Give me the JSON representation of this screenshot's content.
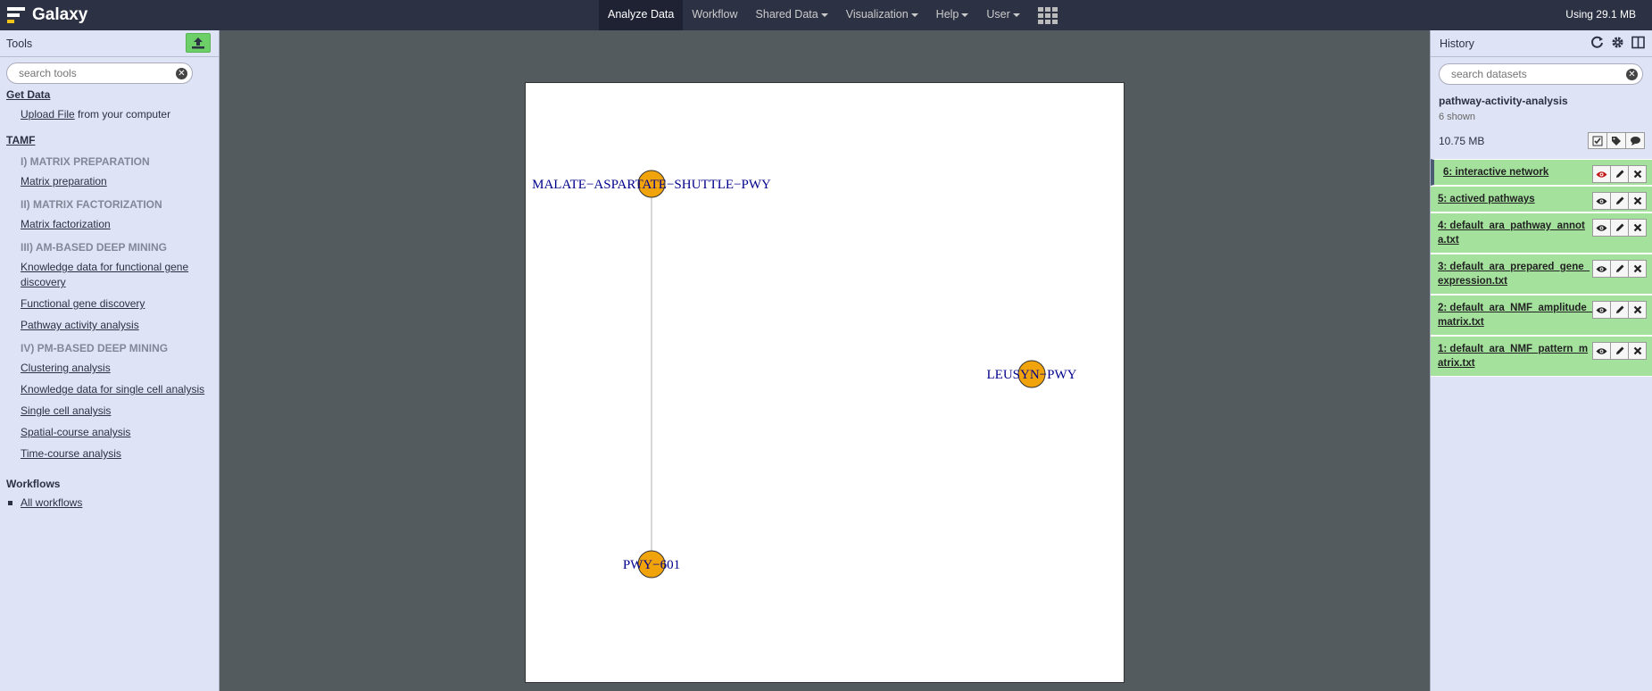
{
  "masthead": {
    "brand": "Galaxy",
    "nav": [
      {
        "label": "Analyze Data",
        "active": true,
        "dropdown": false
      },
      {
        "label": "Workflow",
        "active": false,
        "dropdown": false
      },
      {
        "label": "Shared Data",
        "active": false,
        "dropdown": true
      },
      {
        "label": "Visualization",
        "active": false,
        "dropdown": true
      },
      {
        "label": "Help",
        "active": false,
        "dropdown": true
      },
      {
        "label": "User",
        "active": false,
        "dropdown": true
      }
    ],
    "quota": "Using 29.1 MB"
  },
  "tools": {
    "title": "Tools",
    "search_placeholder": "search tools",
    "get_data": {
      "title": "Get Data",
      "upload_link": "Upload File",
      "upload_suffix": " from your computer"
    },
    "section_title": "TAMF",
    "items": [
      {
        "type": "label",
        "text": "I) MATRIX PREPARATION"
      },
      {
        "type": "link",
        "text": "Matrix preparation"
      },
      {
        "type": "label",
        "text": "II) MATRIX FACTORIZATION"
      },
      {
        "type": "link",
        "text": "Matrix factorization"
      },
      {
        "type": "label",
        "text": "III) AM-BASED DEEP MINING"
      },
      {
        "type": "link",
        "text": "Knowledge data for functional gene discovery"
      },
      {
        "type": "link",
        "text": "Functional gene discovery"
      },
      {
        "type": "link",
        "text": "Pathway activity analysis"
      },
      {
        "type": "label",
        "text": "IV) PM-BASED DEEP MINING"
      },
      {
        "type": "link",
        "text": "Clustering analysis"
      },
      {
        "type": "link",
        "text": "Knowledge data for single cell analysis"
      },
      {
        "type": "link",
        "text": "Single cell analysis"
      },
      {
        "type": "link",
        "text": "Spatial-course analysis"
      },
      {
        "type": "link",
        "text": "Time-course analysis"
      }
    ],
    "workflows_title": "Workflows",
    "workflows_link": "All workflows"
  },
  "network": {
    "nodes": [
      {
        "id": "malate",
        "label": "MALATE−ASPARTATE−SHUTTLE−PWY"
      },
      {
        "id": "leusyn",
        "label": "LEUSYN−PWY"
      },
      {
        "id": "pwy601",
        "label": "PWY−601"
      }
    ],
    "edges": [
      {
        "source": "malate",
        "target": "pwy601"
      }
    ],
    "node_color": "#f0a30a",
    "label_color": "#00008b"
  },
  "history": {
    "title": "History",
    "search_placeholder": "search datasets",
    "name": "pathway-activity-analysis",
    "shown": "6 shown",
    "size": "10.75 MB",
    "datasets": [
      {
        "title": "6: interactive network",
        "current": true
      },
      {
        "title": "5: actived pathways",
        "current": false
      },
      {
        "title": "4: default_ara_pathway_annota.txt",
        "current": false
      },
      {
        "title": "3: default_ara_prepared_gene_expression.txt",
        "current": false
      },
      {
        "title": "2: default_ara_NMF_amplitude_matrix.txt",
        "current": false
      },
      {
        "title": "1: default_ara_NMF_pattern_matrix.txt",
        "current": false
      }
    ]
  }
}
